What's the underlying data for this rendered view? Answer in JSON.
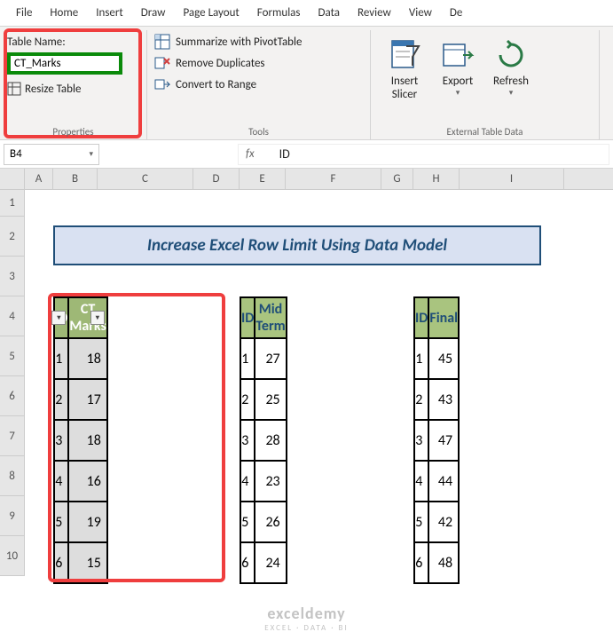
{
  "tabs": [
    "File",
    "Home",
    "Insert",
    "Draw",
    "Page Layout",
    "Formulas",
    "Data",
    "Review",
    "View",
    "De"
  ],
  "ribbon": {
    "tablename_label": "Table Name:",
    "tablename_value": "CT_Marks",
    "resize_label": "Resize Table",
    "properties_label": "Properties",
    "summarize": "Summarize with PivotTable",
    "duplicates": "Remove Duplicates",
    "convert": "Convert to Range",
    "tools_label": "Tools",
    "slicer_top": "Insert",
    "slicer_bot": "Slicer",
    "export": "Export",
    "refresh": "Refresh",
    "extdata_label": "External Table Data"
  },
  "namebox": "B4",
  "formula": "ID",
  "cols": [
    "A",
    "B",
    "C",
    "D",
    "E",
    "F",
    "G",
    "H",
    "I"
  ],
  "rows": [
    "1",
    "2",
    "3",
    "4",
    "5",
    "6",
    "7",
    "8",
    "9",
    "10"
  ],
  "banner": "Increase Excel Row Limit Using Data Model",
  "chart_data": {
    "type": "table",
    "tables": [
      {
        "name": "CT_Marks",
        "headers": [
          "ID",
          "CT Marks"
        ],
        "data": [
          [
            1,
            18
          ],
          [
            2,
            17
          ],
          [
            3,
            18
          ],
          [
            4,
            16
          ],
          [
            5,
            19
          ],
          [
            6,
            15
          ]
        ]
      },
      {
        "name": "Mid",
        "headers": [
          "ID",
          "Mid Term"
        ],
        "data": [
          [
            1,
            27
          ],
          [
            2,
            25
          ],
          [
            3,
            28
          ],
          [
            4,
            23
          ],
          [
            5,
            26
          ],
          [
            6,
            24
          ]
        ]
      },
      {
        "name": "Final",
        "headers": [
          "ID",
          "Final"
        ],
        "data": [
          [
            1,
            45
          ],
          [
            2,
            43
          ],
          [
            3,
            47
          ],
          [
            4,
            44
          ],
          [
            5,
            42
          ],
          [
            6,
            48
          ]
        ]
      }
    ]
  },
  "watermark": {
    "top": "exceldemy",
    "bot": "EXCEL · DATA · BI"
  }
}
